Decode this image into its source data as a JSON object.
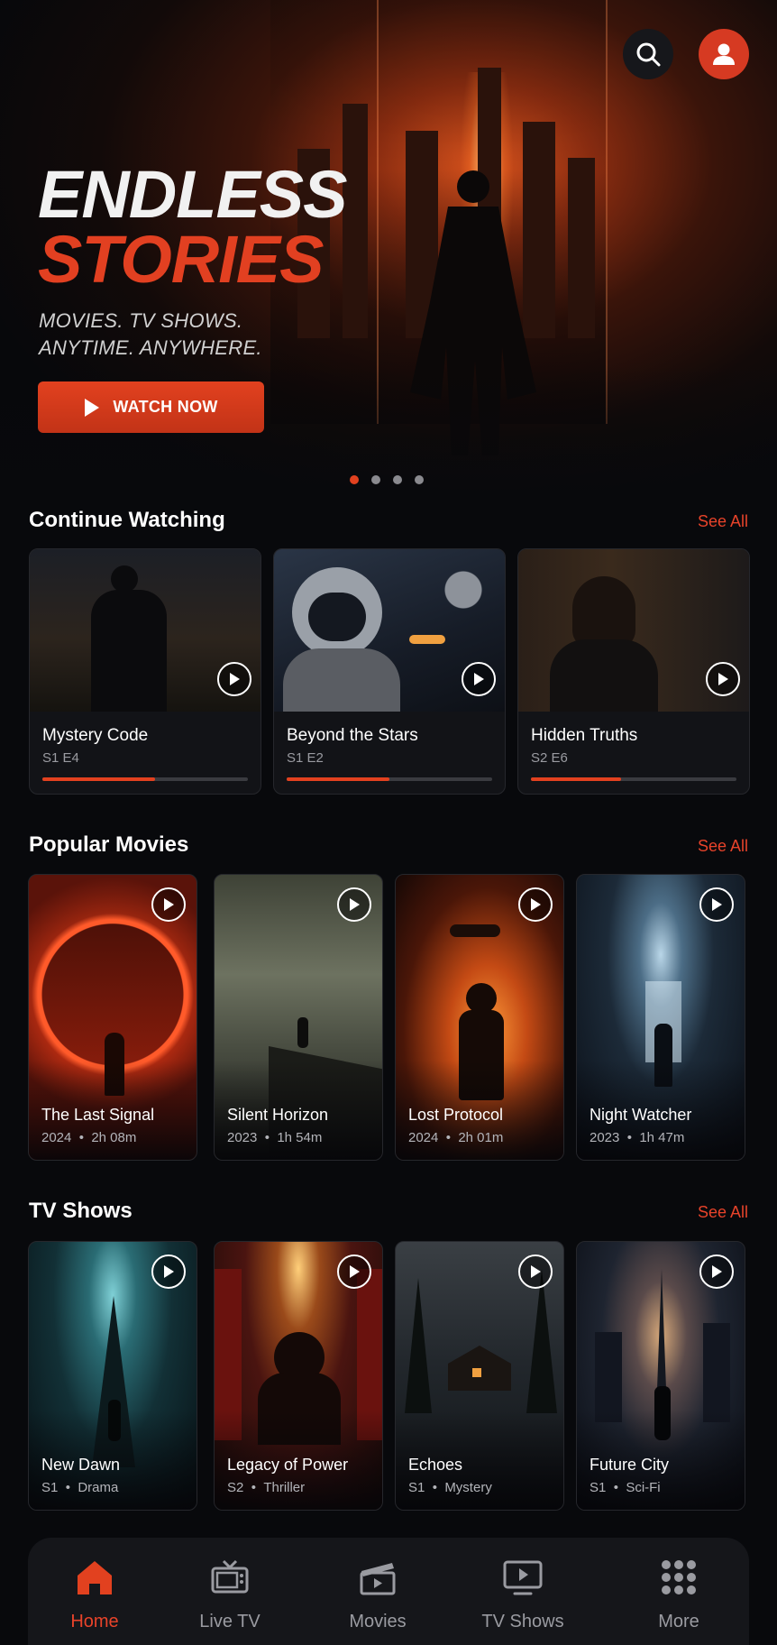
{
  "hero": {
    "title_line1": "ENDLESS",
    "title_line2": "STORIES",
    "subtitle_line1": "MOVIES. TV SHOWS.",
    "subtitle_line2": "ANYTIME. ANYWHERE.",
    "cta_label": "WATCH NOW",
    "carousel_pages": 4,
    "carousel_active": 1,
    "icons": {
      "search": "search-icon",
      "profile": "user-icon",
      "cta": "play-icon"
    }
  },
  "continue_watching": {
    "title": "Continue Watching",
    "see_all": "See All",
    "items": [
      {
        "title": "Mystery Code",
        "episode": "S1 E4",
        "progress": 0.55
      },
      {
        "title": "Beyond the Stars",
        "episode": "S1 E2",
        "progress": 0.5
      },
      {
        "title": "Hidden Truths",
        "episode": "S2 E6",
        "progress": 0.44
      }
    ]
  },
  "popular_movies": {
    "title": "Popular Movies",
    "see_all": "See All",
    "items": [
      {
        "title": "The Last Signal",
        "year": "2024",
        "duration": "2h 08m"
      },
      {
        "title": "Silent Horizon",
        "year": "2023",
        "duration": "1h 54m"
      },
      {
        "title": "Lost Protocol",
        "year": "2024",
        "duration": "2h 01m"
      },
      {
        "title": "Night Watcher",
        "year": "2023",
        "duration": "1h 47m"
      }
    ]
  },
  "tv_shows": {
    "title": "TV Shows",
    "see_all": "See All",
    "items": [
      {
        "title": "New Dawn",
        "season": "S1",
        "genre": "Drama"
      },
      {
        "title": "Legacy of Power",
        "season": "S2",
        "genre": "Thriller"
      },
      {
        "title": "Echoes",
        "season": "S1",
        "genre": "Mystery"
      },
      {
        "title": "Future City",
        "season": "S1",
        "genre": "Sci-Fi"
      }
    ]
  },
  "separator": "•",
  "bottom_nav": {
    "active": "Home",
    "items": [
      {
        "label": "Home",
        "icon": "home-icon"
      },
      {
        "label": "Live TV",
        "icon": "tv-icon"
      },
      {
        "label": "Movies",
        "icon": "clapperboard-icon"
      },
      {
        "label": "TV Shows",
        "icon": "monitor-play-icon"
      },
      {
        "label": "More",
        "icon": "grid-icon"
      }
    ]
  },
  "colors": {
    "accent": "#e2411f",
    "background": "#08090c",
    "card": "#121317",
    "muted_text": "#9a9ba1"
  }
}
